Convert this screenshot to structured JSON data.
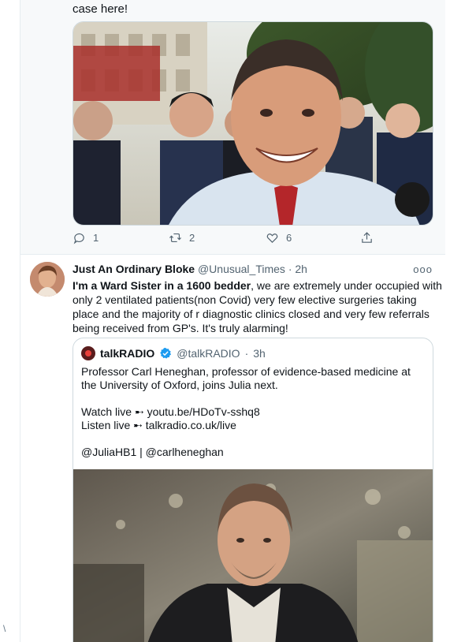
{
  "tweet_top": {
    "text": "case here!",
    "image_alt": "Group of smiling men in suits on a London street",
    "actions": {
      "reply_count": "1",
      "retweet_count": "2",
      "like_count": "6"
    }
  },
  "tweet_reply": {
    "display_name": "Just An Ordinary Bloke",
    "handle": "@Unusual_Times",
    "separator": "·",
    "time": "2h",
    "more": "ooo",
    "body_bold": "I'm a Ward Sister in a 1600 bedder",
    "body_rest": ", we are extremely under occupied with only 2 ventilated patients(non Covid) very few elective surgeries taking place and the majority of r diagnostic clinics closed and very few referrals being received from GP's. It's truly alarming!"
  },
  "quoted_tweet": {
    "display_name": "talkRADIO",
    "handle": "@talkRADIO",
    "separator": "·",
    "time": "3h",
    "paragraph1": "Professor Carl Heneghan,  professor of evidence-based medicine at the University of Oxford, joins Julia next.",
    "watch_line": "Watch live ➸ youtu.be/HDoTv-sshq8",
    "listen_line": "Listen live ➸ talkradio.co.uk/live",
    "mentions": "@JuliaHB1 | @carlheneghan",
    "image_alt": "Portrait of a bearded man in a dark jacket in an office"
  },
  "gutter": {
    "mark": "\\"
  },
  "colors": {
    "accent": "#1d9bf0",
    "muted": "#536471",
    "border": "#cfd9de",
    "highlight_bg": "#f7f9fa"
  }
}
